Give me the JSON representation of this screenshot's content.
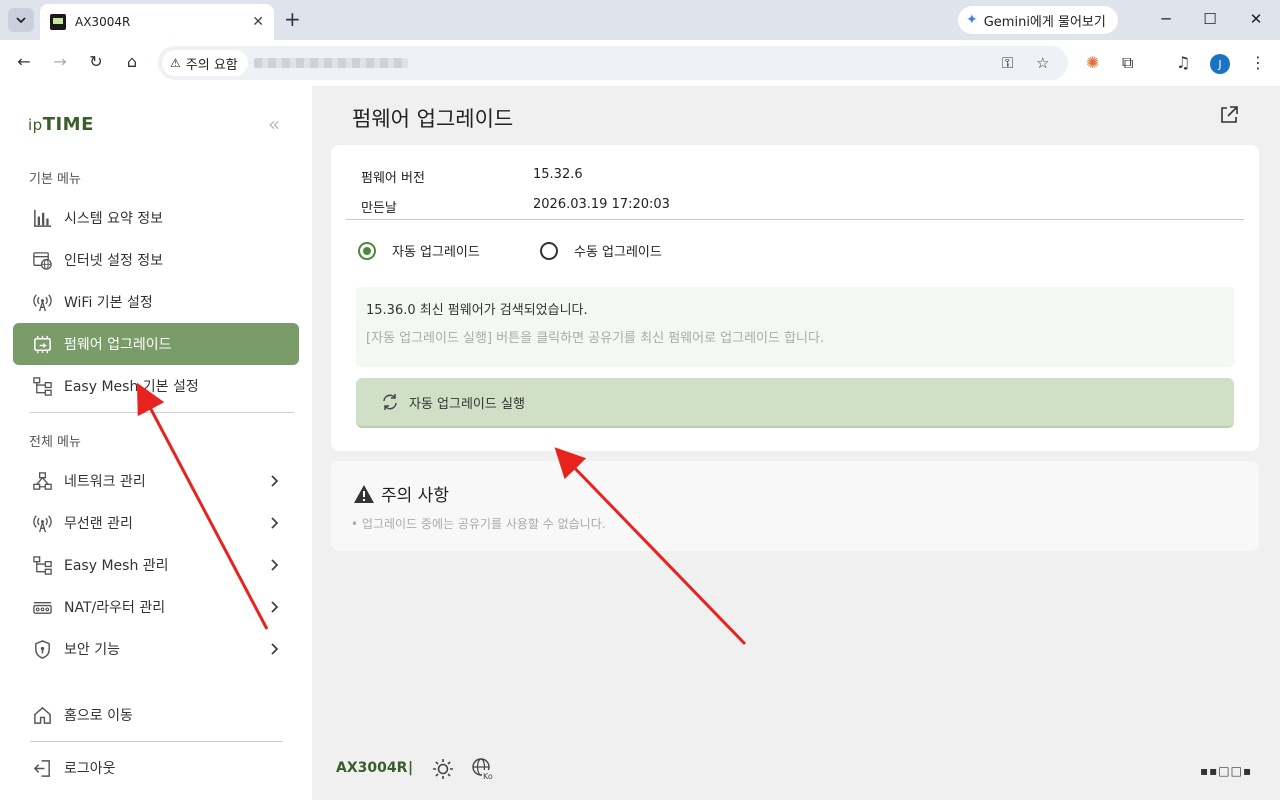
{
  "browser": {
    "tab_title": "AX3004R",
    "tab_close": "✕",
    "new_tab": "+",
    "gemini_label": "Gemini에게 물어보기",
    "security_label": "주의 요함",
    "profile_initial": "J"
  },
  "sidebar": {
    "logo_ip": "ip",
    "logo_time": "TIME",
    "section_basic": "기본 메뉴",
    "basic_items": [
      {
        "label": "시스템 요약 정보",
        "icon": "bar-chart-icon"
      },
      {
        "label": "인터넷 설정 정보",
        "icon": "globe-window-icon"
      },
      {
        "label": "WiFi 기본 설정",
        "icon": "wifi-antenna-icon"
      },
      {
        "label": "펌웨어 업그레이드",
        "icon": "firmware-chip-icon"
      },
      {
        "label": "Easy Mesh 기본 설정",
        "icon": "mesh-tree-icon"
      }
    ],
    "section_all": "전체 메뉴",
    "all_items": [
      {
        "label": "네트워크 관리",
        "icon": "network-icon"
      },
      {
        "label": "무선랜 관리",
        "icon": "wifi-antenna-icon"
      },
      {
        "label": "Easy Mesh 관리",
        "icon": "mesh-tree-icon"
      },
      {
        "label": "NAT/라우터 관리",
        "icon": "router-icon"
      },
      {
        "label": "보안 기능",
        "icon": "shield-icon"
      }
    ],
    "home_label": "홈으로 이동",
    "logout_label": "로그아웃"
  },
  "main": {
    "title": "펌웨어 업그레이드",
    "firmware_version_label": "펌웨어 버전",
    "firmware_version": "15.32.6",
    "build_date_label": "만든날",
    "build_date": "2026.03.19 17:20:03",
    "radio_auto": "자동 업그레이드",
    "radio_manual": "수동 업그레이드",
    "notice_line1": "15.36.0 최신 펌웨어가 검색되었습니다.",
    "notice_line2": "[자동 업그레이드 실행] 버튼을 클릭하면 공유기를 최신 펌웨어로 업그레이드 합니다.",
    "run_button": "자동 업그레이드 실행",
    "caution_title": "주의 사항",
    "caution_text": "• 업그레이드 중에는 공유기를 사용할 수 없습니다."
  },
  "footer": {
    "model": "AX3004R",
    "separator": "|",
    "lang_code": "Ko",
    "grid_glyphs": "▪▪□□▪"
  },
  "colors": {
    "accent": "#7a9c69",
    "brand_green": "#3a5e2a",
    "button_green": "#cfe0c6",
    "annotation_red": "#e8231e"
  }
}
